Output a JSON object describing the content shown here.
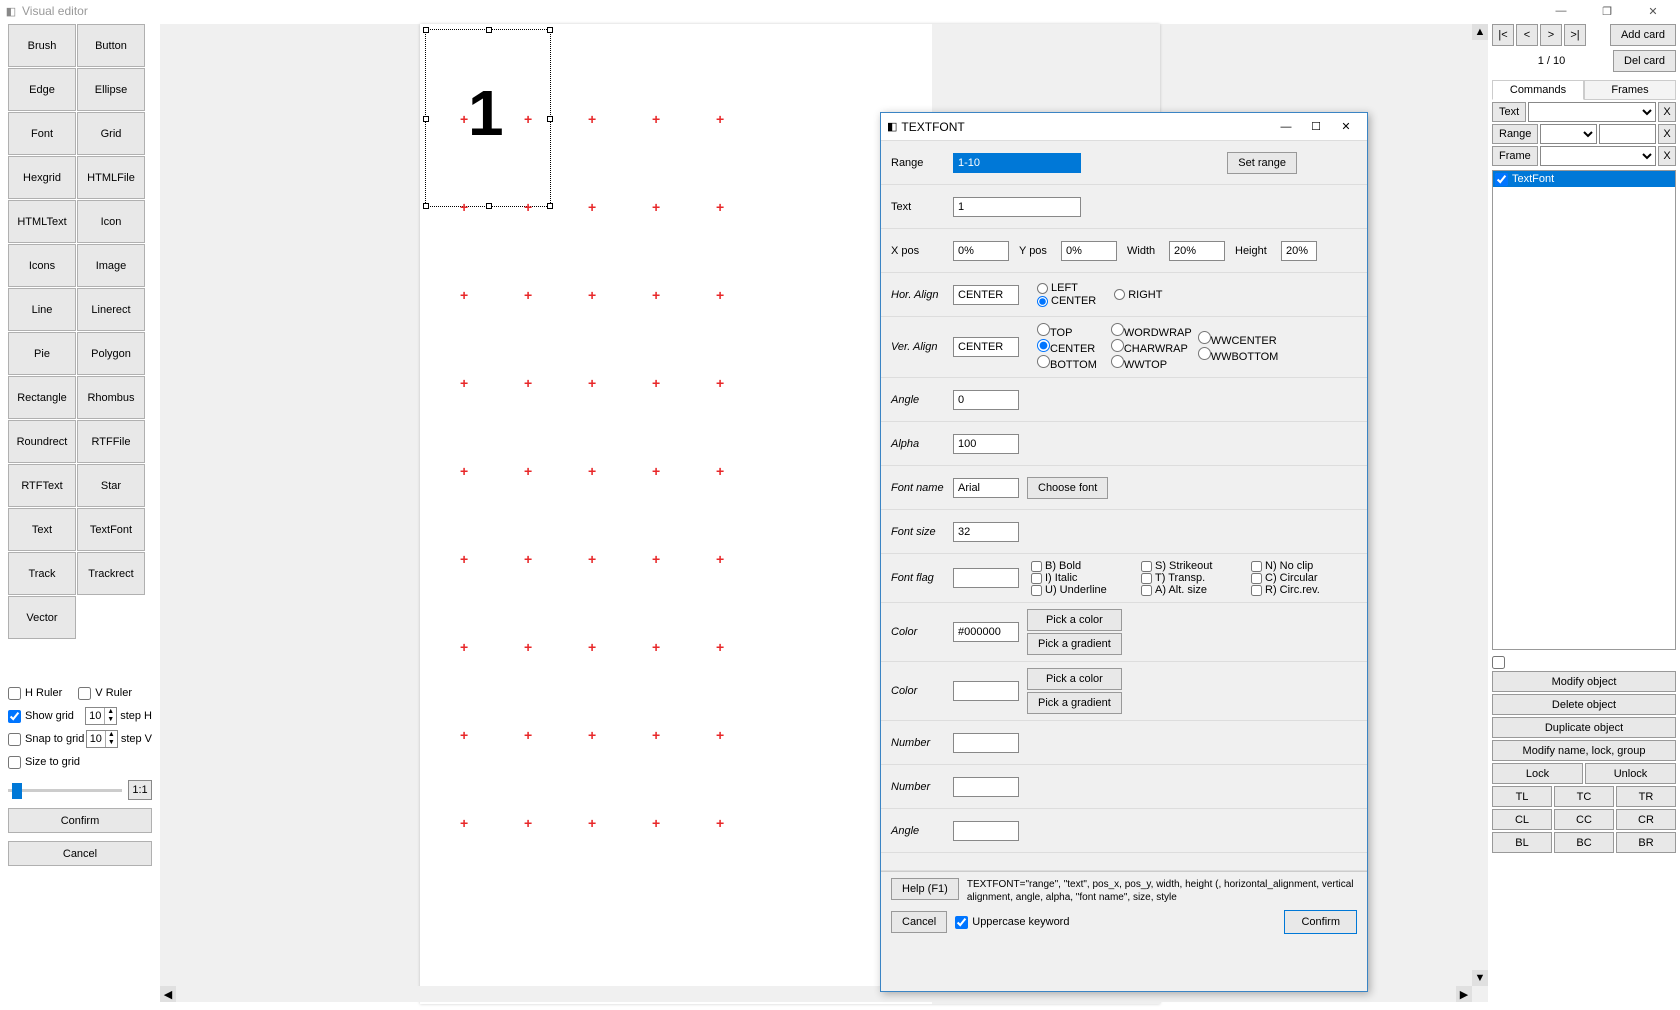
{
  "app": {
    "title": "Visual editor"
  },
  "win": {
    "min": "—",
    "max": "❐",
    "close": "✕"
  },
  "tools": [
    "Brush",
    "Button",
    "Edge",
    "Ellipse",
    "Font",
    "Grid",
    "Hexgrid",
    "HTMLFile",
    "HTMLText",
    "Icon",
    "Icons",
    "Image",
    "Line",
    "Linerect",
    "Pie",
    "Polygon",
    "Rectangle",
    "Rhombus",
    "Roundrect",
    "RTFFile",
    "RTFText",
    "Star",
    "Text",
    "TextFont",
    "Track",
    "Trackrect",
    "Vector"
  ],
  "opts": {
    "hruler": "H Ruler",
    "vruler": "V Ruler",
    "showgrid": "Show grid",
    "snap": "Snap to grid",
    "size": "Size to grid",
    "stepH": "step H",
    "stepV": "step V",
    "stepHval": "10",
    "stepVval": "10",
    "ratio": "1:1",
    "confirm": "Confirm",
    "cancel": "Cancel"
  },
  "canvas": {
    "bignum": "1"
  },
  "right": {
    "nav": {
      "first": "|<",
      "prev": "<",
      "next": ">",
      "last": ">|",
      "add": "Add card",
      "del": "Del card"
    },
    "counter": "1 / 10",
    "tabs": {
      "commands": "Commands",
      "frames": "Frames"
    },
    "props": {
      "text": "Text",
      "range": "Range",
      "frame": "Frame",
      "x": "X"
    },
    "listitem": "TextFont",
    "actions": {
      "modify": "Modify object",
      "delete": "Delete object",
      "dup": "Duplicate object",
      "rename": "Modify name, lock, group",
      "lock": "Lock",
      "unlock": "Unlock"
    },
    "pos": [
      "TL",
      "TC",
      "TR",
      "CL",
      "CC",
      "CR",
      "BL",
      "BC",
      "BR"
    ]
  },
  "dialog": {
    "title": "TEXTFONT",
    "range": {
      "label": "Range",
      "value": "1-10",
      "setrange": "Set range"
    },
    "text": {
      "label": "Text",
      "value": "1"
    },
    "pos": {
      "xlabel": "X pos",
      "x": "0%",
      "ylabel": "Y pos",
      "y": "0%",
      "wlabel": "Width",
      "w": "20%",
      "hlabel": "Height",
      "h": "20%"
    },
    "halign": {
      "label": "Hor. Align",
      "value": "CENTER",
      "opts": [
        "LEFT",
        "CENTER",
        "RIGHT"
      ]
    },
    "valign": {
      "label": "Ver. Align",
      "value": "CENTER",
      "col1": [
        "TOP",
        "CENTER",
        "BOTTOM"
      ],
      "col2": [
        "WORDWRAP",
        "CHARWRAP",
        "WWTOP"
      ],
      "col3": [
        "WWCENTER",
        "WWBOTTOM"
      ]
    },
    "angle": {
      "label": "Angle",
      "value": "0"
    },
    "alpha": {
      "label": "Alpha",
      "value": "100"
    },
    "fontname": {
      "label": "Font name",
      "value": "Arial",
      "choose": "Choose font"
    },
    "fontsize": {
      "label": "Font size",
      "value": "32"
    },
    "fontflag": {
      "label": "Font flag",
      "flags": [
        "B) Bold",
        "I) Italic",
        "U) Underline",
        "S) Strikeout",
        "T) Transp.",
        "A) Alt. size",
        "N) No clip",
        "C) Circular",
        "R) Circ.rev."
      ]
    },
    "color1": {
      "label": "Color",
      "value": "#000000",
      "pick": "Pick a color",
      "grad": "Pick a gradient"
    },
    "color2": {
      "label": "Color",
      "value": "",
      "pick": "Pick a color",
      "grad": "Pick a gradient"
    },
    "number1": {
      "label": "Number",
      "value": ""
    },
    "number2": {
      "label": "Number",
      "value": ""
    },
    "angle2": {
      "label": "Angle",
      "value": ""
    },
    "footer": {
      "help": "Help (F1)",
      "helptext": "TEXTFONT=\"range\", \"text\", pos_x, pos_y, width, height (, horizontal_alignment, vertical alignment, angle, alpha, \"font name\", size, style",
      "cancel": "Cancel",
      "upper": "Uppercase keyword",
      "confirm": "Confirm"
    }
  }
}
